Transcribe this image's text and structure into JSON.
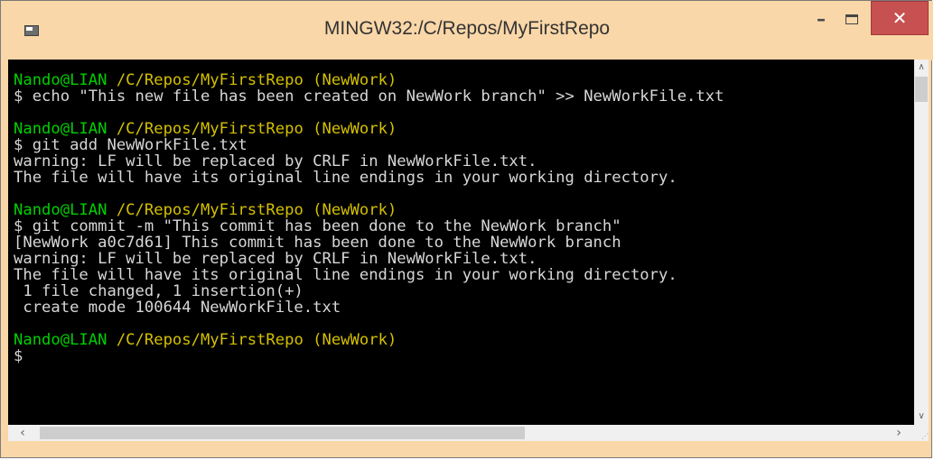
{
  "window": {
    "title": "MINGW32:/C/Repos/MyFirstRepo",
    "controls": {
      "minimize": "–",
      "maximize": "",
      "close": "✕"
    }
  },
  "console": {
    "lines": [
      {
        "type": "prompt",
        "user": "Nando@LIAN",
        "path": " /C/Repos/MyFirstRepo (NewWork)"
      },
      {
        "type": "text",
        "text": "$ echo \"This new file has been created on NewWork branch\" >> NewWorkFile.txt"
      },
      {
        "type": "blank"
      },
      {
        "type": "prompt",
        "user": "Nando@LIAN",
        "path": " /C/Repos/MyFirstRepo (NewWork)"
      },
      {
        "type": "text",
        "text": "$ git add NewWorkFile.txt"
      },
      {
        "type": "text",
        "text": "warning: LF will be replaced by CRLF in NewWorkFile.txt."
      },
      {
        "type": "text",
        "text": "The file will have its original line endings in your working directory."
      },
      {
        "type": "blank"
      },
      {
        "type": "prompt",
        "user": "Nando@LIAN",
        "path": " /C/Repos/MyFirstRepo (NewWork)"
      },
      {
        "type": "text",
        "text": "$ git commit -m \"This commit has been done to the NewWork branch\""
      },
      {
        "type": "text",
        "text": "[NewWork a0c7d61] This commit has been done to the NewWork branch"
      },
      {
        "type": "text",
        "text": "warning: LF will be replaced by CRLF in NewWorkFile.txt."
      },
      {
        "type": "text",
        "text": "The file will have its original line endings in your working directory."
      },
      {
        "type": "text",
        "text": " 1 file changed, 1 insertion(+)"
      },
      {
        "type": "text",
        "text": " create mode 100644 NewWorkFile.txt"
      },
      {
        "type": "blank"
      },
      {
        "type": "prompt",
        "user": "Nando@LIAN",
        "path": " /C/Repos/MyFirstRepo (NewWork)"
      },
      {
        "type": "text",
        "text": "$"
      }
    ]
  },
  "scrollbars": {
    "vertical": {
      "up": "∧",
      "down": "∨"
    },
    "horizontal": {
      "left": "‹",
      "right": "›"
    }
  }
}
